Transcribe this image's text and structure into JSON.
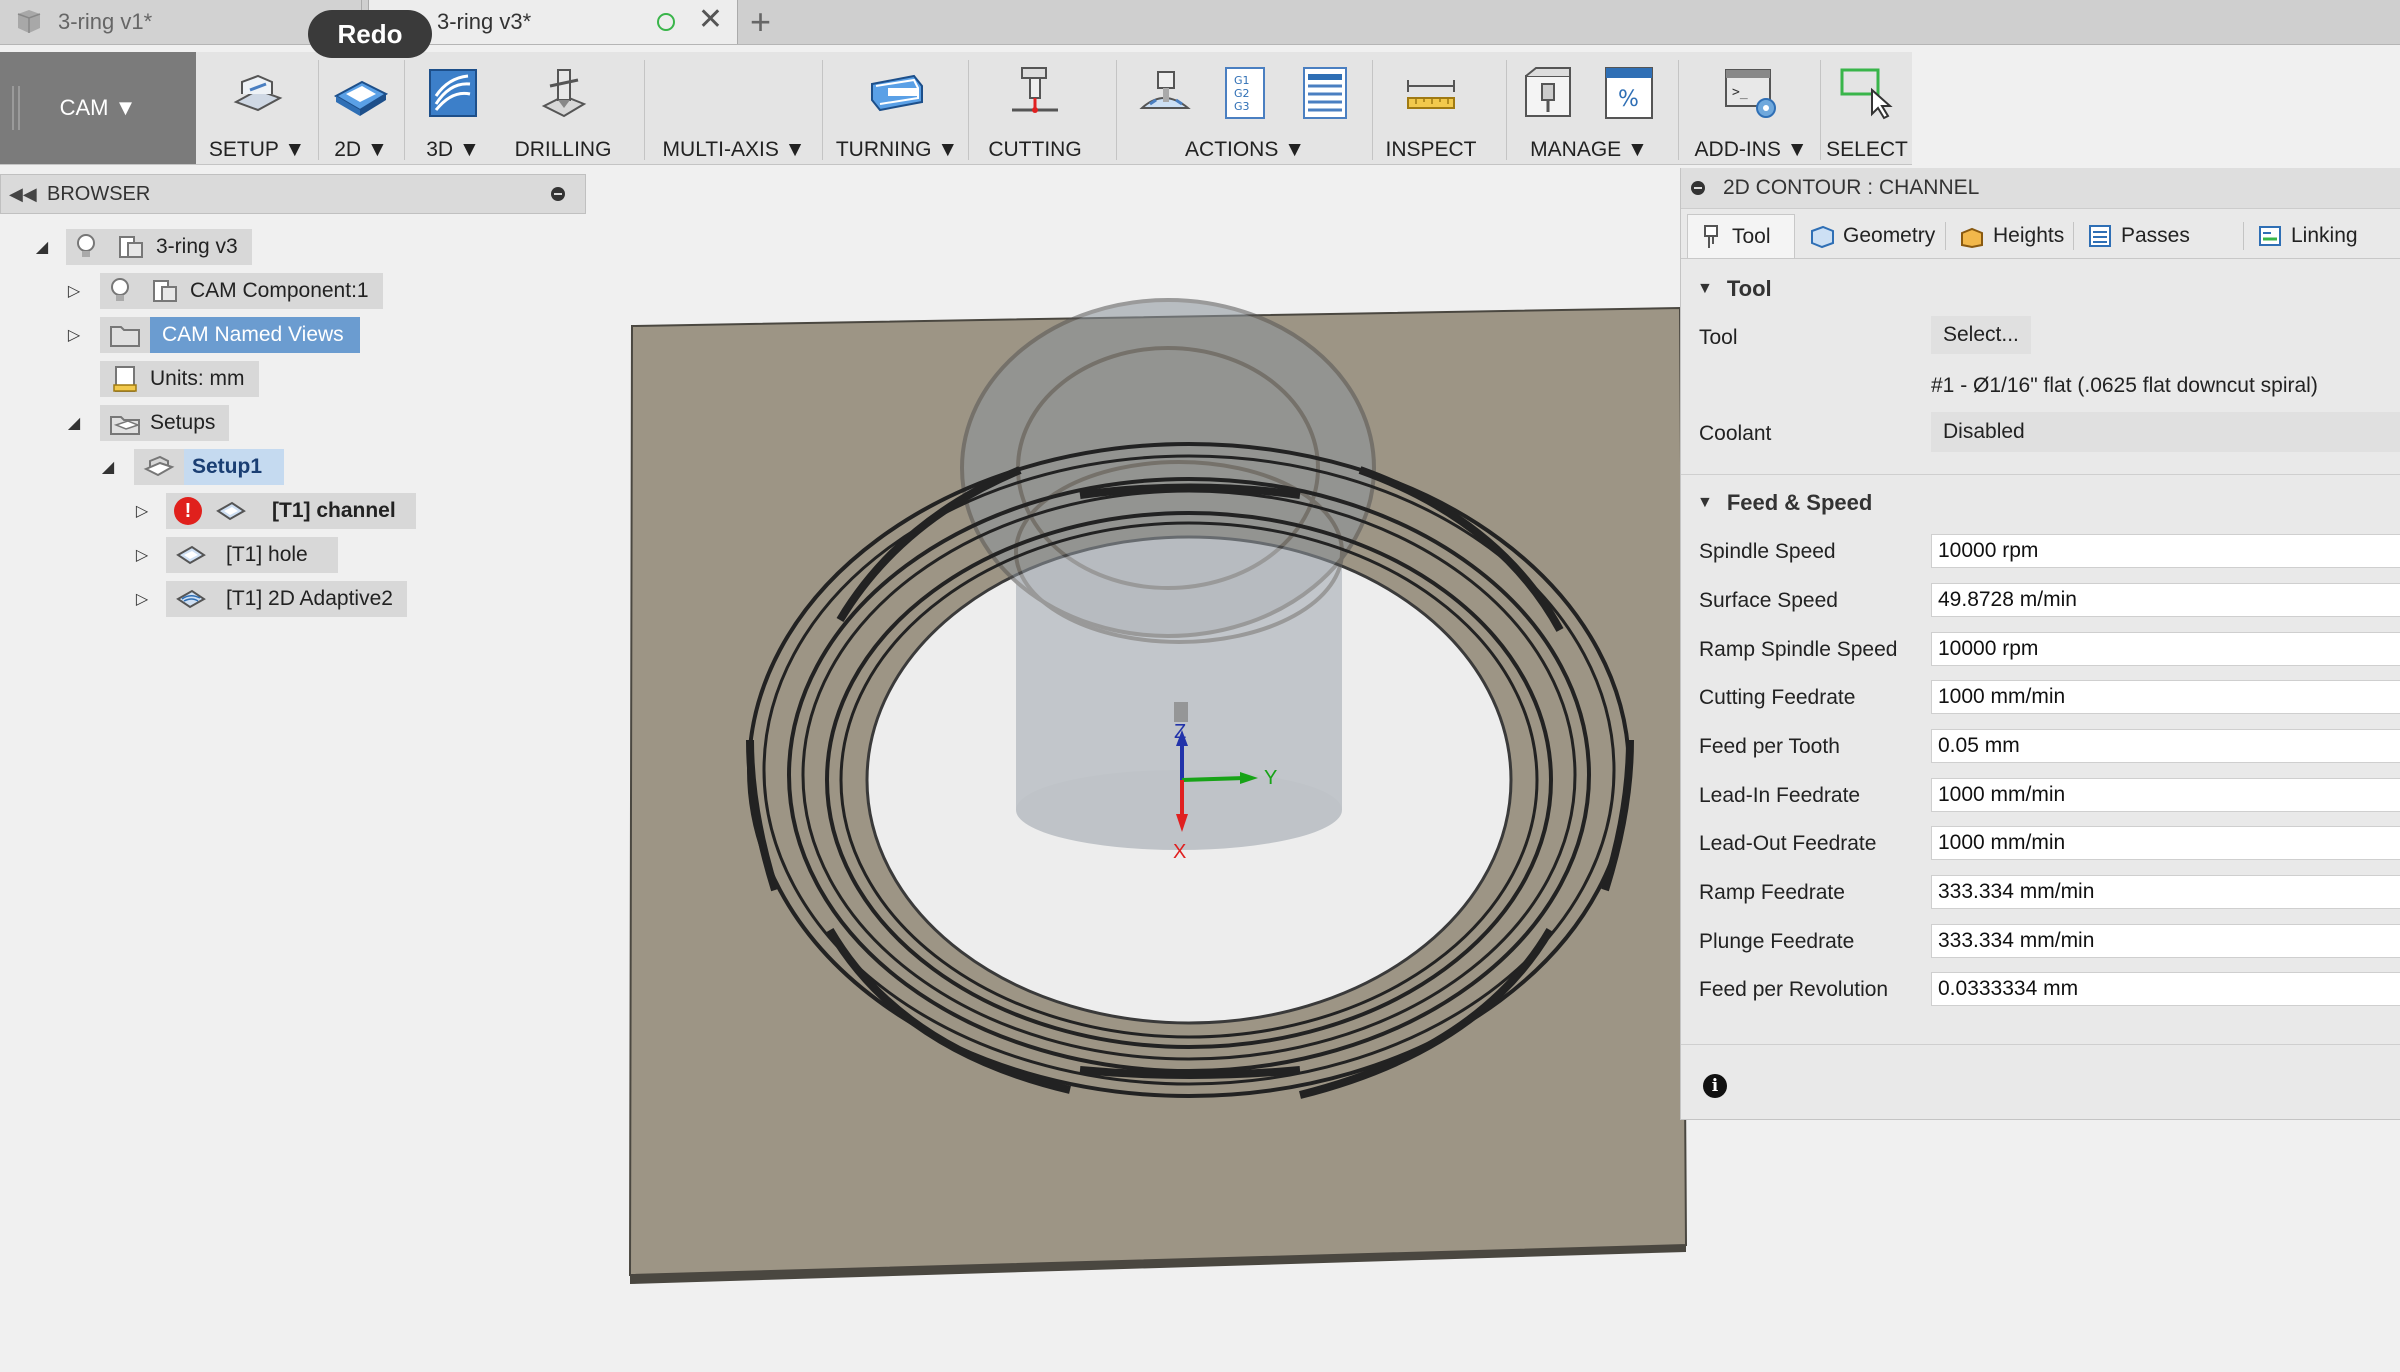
{
  "tabs": [
    {
      "title": "3-ring v1*",
      "active": false
    },
    {
      "title": "3-ring v3*",
      "active": true
    }
  ],
  "tooltip": "Redo",
  "toolbar": {
    "workspace": "CAM",
    "groups": [
      {
        "label": "SETUP",
        "dropdown": true
      },
      {
        "label": "2D",
        "dropdown": true
      },
      {
        "label": "3D",
        "dropdown": true
      },
      {
        "label": "DRILLING",
        "dropdown": false
      },
      {
        "label": "MULTI-AXIS",
        "dropdown": true
      },
      {
        "label": "TURNING",
        "dropdown": true
      },
      {
        "label": "CUTTING",
        "dropdown": false
      },
      {
        "label": "ACTIONS",
        "dropdown": true
      },
      {
        "label": "INSPECT",
        "dropdown": false
      },
      {
        "label": "MANAGE",
        "dropdown": true
      },
      {
        "label": "ADD-INS",
        "dropdown": true
      },
      {
        "label": "SELECT",
        "dropdown": false
      }
    ]
  },
  "browser": {
    "title": "BROWSER",
    "nodes": [
      {
        "label": "3-ring v3",
        "icon": "component-icon",
        "bulb": true
      },
      {
        "label": "CAM Component:1",
        "icon": "component-icon",
        "bulb": true
      },
      {
        "label": "CAM Named Views",
        "icon": "folder-icon",
        "selected": true
      },
      {
        "label": "Units: mm",
        "icon": "units-icon"
      },
      {
        "label": "Setups",
        "icon": "setup-folder-icon"
      },
      {
        "label": "Setup1",
        "icon": "setup-icon",
        "highlighted": true
      },
      {
        "label": "[T1] channel",
        "icon": "contour-op-icon",
        "error": true
      },
      {
        "label": "[T1] hole",
        "icon": "contour-op-icon"
      },
      {
        "label": "[T1] 2D Adaptive2",
        "icon": "adaptive-op-icon"
      }
    ]
  },
  "viewport": {
    "axes": {
      "x": "X",
      "y": "Y",
      "z": "Z"
    },
    "colors": {
      "stock": "#9d9585",
      "x_axis": "#e02020",
      "y_axis": "#17a317",
      "z_axis": "#2233aa"
    }
  },
  "panel": {
    "title": "2D CONTOUR : CHANNEL",
    "tabs": [
      "Tool",
      "Geometry",
      "Heights",
      "Passes",
      "Linking"
    ],
    "active_tab": "Tool",
    "tool_section": {
      "heading": "Tool",
      "tool_label": "Tool",
      "tool_button": "Select...",
      "tool_desc": "#1 - Ø1/16\" flat (.0625 flat downcut spiral)",
      "coolant_label": "Coolant",
      "coolant_value": "Disabled"
    },
    "feed_section": {
      "heading": "Feed & Speed",
      "rows": [
        {
          "label": "Spindle Speed",
          "value": "10000 rpm"
        },
        {
          "label": "Surface Speed",
          "value": "49.8728 m/min"
        },
        {
          "label": "Ramp Spindle Speed",
          "value": "10000 rpm"
        },
        {
          "label": "Cutting Feedrate",
          "value": "1000 mm/min"
        },
        {
          "label": "Feed per Tooth",
          "value": "0.05 mm"
        },
        {
          "label": "Lead-In Feedrate",
          "value": "1000 mm/min"
        },
        {
          "label": "Lead-Out Feedrate",
          "value": "1000 mm/min"
        },
        {
          "label": "Ramp Feedrate",
          "value": "333.334 mm/min"
        },
        {
          "label": "Plunge Feedrate",
          "value": "333.334 mm/min"
        },
        {
          "label": "Feed per Revolution",
          "value": "0.0333334 mm"
        }
      ]
    }
  }
}
